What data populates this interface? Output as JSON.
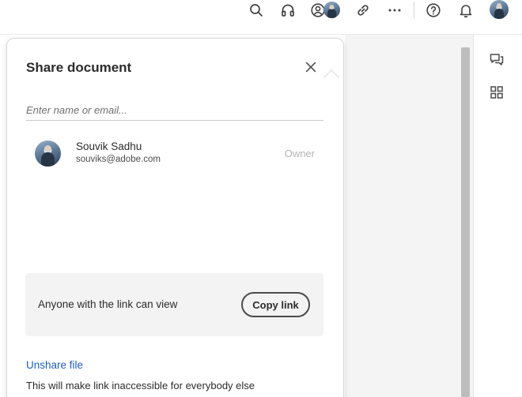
{
  "toolbar": {
    "icons": [
      "search-icon",
      "headphones-icon",
      "share-people-icon",
      "link-icon",
      "more-icon",
      "help-icon",
      "bell-icon"
    ]
  },
  "share_panel": {
    "title": "Share document",
    "input_placeholder": "Enter name or email...",
    "user": {
      "name": "Souvik Sadhu",
      "email": "souviks@adobe.com",
      "role": "Owner"
    },
    "link_access_text": "Anyone with the link can view",
    "copy_link_label": "Copy link",
    "unshare_label": "Unshare file",
    "unshare_description": "This will make link inaccessible for everybody else"
  },
  "sidebar": {
    "icons": [
      "comment-icon",
      "apps-grid-icon"
    ]
  },
  "colors": {
    "link_blue": "#1d5fc4",
    "panel_border": "#d8d8d8",
    "link_box_bg": "#f3f3f3"
  }
}
